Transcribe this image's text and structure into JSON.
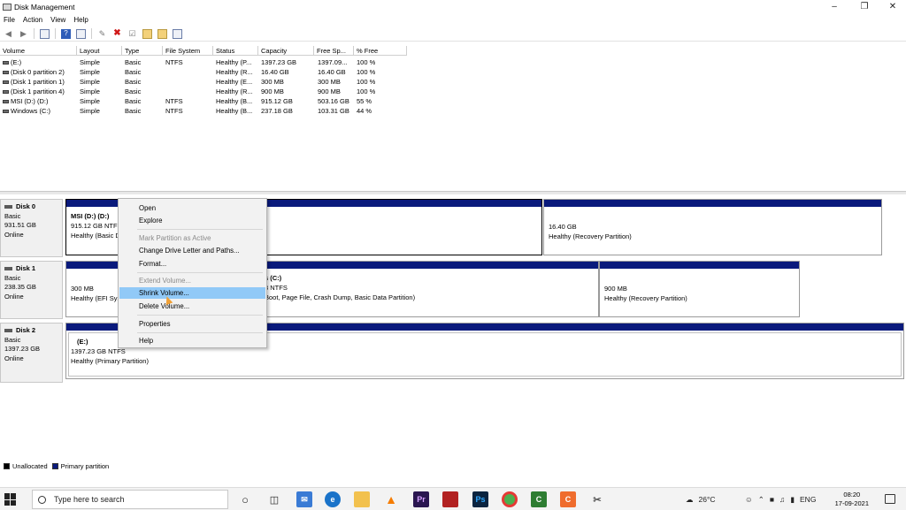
{
  "window": {
    "title": "Disk Management",
    "controls": [
      "minimize",
      "maximize",
      "close"
    ]
  },
  "menu": [
    "File",
    "Action",
    "View",
    "Help"
  ],
  "toolbar": {
    "icons": [
      "back-arrow-icon",
      "forward-arrow-icon",
      "console-icon",
      "help-icon",
      "properties-icon",
      "connect-icon",
      "delete-icon",
      "check-icon",
      "folder-icon",
      "folder-search-icon",
      "disk-view-icon"
    ]
  },
  "volume_table": {
    "columns": [
      "Volume",
      "Layout",
      "Type",
      "File System",
      "Status",
      "Capacity",
      "Free Sp...",
      "% Free"
    ],
    "rows": [
      {
        "volume": "(E:)",
        "layout": "Simple",
        "type": "Basic",
        "fs": "NTFS",
        "status": "Healthy (P...",
        "capacity": "1397.23 GB",
        "free": "1397.09...",
        "pct": "100 %"
      },
      {
        "volume": "(Disk 0 partition 2)",
        "layout": "Simple",
        "type": "Basic",
        "fs": "",
        "status": "Healthy (R...",
        "capacity": "16.40 GB",
        "free": "16.40 GB",
        "pct": "100 %"
      },
      {
        "volume": "(Disk 1 partition 1)",
        "layout": "Simple",
        "type": "Basic",
        "fs": "",
        "status": "Healthy (E...",
        "capacity": "300 MB",
        "free": "300 MB",
        "pct": "100 %"
      },
      {
        "volume": "(Disk 1 partition 4)",
        "layout": "Simple",
        "type": "Basic",
        "fs": "",
        "status": "Healthy (R...",
        "capacity": "900 MB",
        "free": "900 MB",
        "pct": "100 %"
      },
      {
        "volume": "MSI (D:) (D:)",
        "layout": "Simple",
        "type": "Basic",
        "fs": "NTFS",
        "status": "Healthy (B...",
        "capacity": "915.12 GB",
        "free": "503.16 GB",
        "pct": "55 %"
      },
      {
        "volume": "Windows (C:)",
        "layout": "Simple",
        "type": "Basic",
        "fs": "NTFS",
        "status": "Healthy (B...",
        "capacity": "237.18 GB",
        "free": "103.31 GB",
        "pct": "44 %"
      }
    ]
  },
  "disks": [
    {
      "name": "Disk 0",
      "type": "Basic",
      "size": "931.51 GB",
      "state": "Online",
      "partitions": [
        {
          "name": "MSI (D:)  (D:)",
          "size": "915.12 GB NTFS",
          "status": "Healthy (Basic D"
        },
        {
          "name": "",
          "size": "16.40 GB",
          "status": "Healthy (Recovery Partition)"
        }
      ]
    },
    {
      "name": "Disk 1",
      "type": "Basic",
      "size": "238.35 GB",
      "state": "Online",
      "partitions": [
        {
          "name": "",
          "size": "300 MB",
          "status": "Healthy (EFI Sys"
        },
        {
          "name": "s  (C:)",
          "size": "3 NTFS",
          "status": "Boot, Page File, Crash Dump, Basic Data Partition)"
        },
        {
          "name": "",
          "size": "900 MB",
          "status": "Healthy (Recovery Partition)"
        }
      ]
    },
    {
      "name": "Disk 2",
      "type": "Basic",
      "size": "1397.23 GB",
      "state": "Online",
      "partitions": [
        {
          "name": "(E:)",
          "size": "1397.23 GB NTFS",
          "status": "Healthy (Primary Partition)"
        }
      ]
    }
  ],
  "context_menu": {
    "items": [
      {
        "label": "Open",
        "disabled": false
      },
      {
        "label": "Explore",
        "disabled": false
      },
      {
        "label": "Mark Partition as Active",
        "disabled": true
      },
      {
        "label": "Change Drive Letter and Paths...",
        "disabled": false
      },
      {
        "label": "Format...",
        "disabled": false
      },
      {
        "label": "Extend Volume...",
        "disabled": true
      },
      {
        "label": "Shrink Volume...",
        "disabled": false,
        "active": true
      },
      {
        "label": "Delete Volume...",
        "disabled": false
      },
      {
        "label": "Properties",
        "disabled": false
      },
      {
        "label": "Help",
        "disabled": false
      }
    ]
  },
  "legend": {
    "unallocated": "Unallocated",
    "primary": "Primary partition",
    "colors": {
      "unallocated": "#000000",
      "primary": "#0a1a7c"
    }
  },
  "taskbar": {
    "search_placeholder": "Type here to search",
    "apps": [
      "task-view-icon",
      "mail-icon",
      "edge-icon",
      "file-explorer-icon",
      "vlc-icon",
      "premiere-icon",
      "red-app-icon",
      "photoshop-icon",
      "chrome-icon",
      "camtasia-icon",
      "orange-app-icon",
      "snipping-icon"
    ],
    "weather": "26°C",
    "language": "ENG",
    "time": "08:20",
    "date": "17-09-2021"
  }
}
